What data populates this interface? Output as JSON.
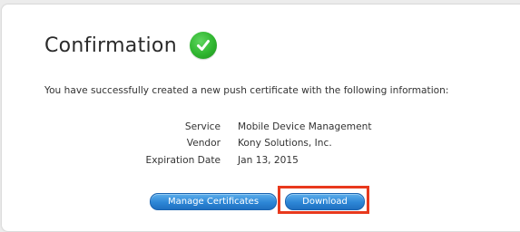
{
  "page": {
    "title": "Confirmation",
    "intro": "You have successfully created a new push certificate with the following information:"
  },
  "details": [
    {
      "label": "Service",
      "value": "Mobile Device Management"
    },
    {
      "label": "Vendor",
      "value": "Kony Solutions, Inc."
    },
    {
      "label": "Expiration Date",
      "value": "Jan 13, 2015"
    }
  ],
  "buttons": {
    "manage_label": "Manage Certificates",
    "download_label": "Download"
  },
  "colors": {
    "success_green": "#2fb52f",
    "button_blue": "#2d86d6",
    "highlight_red": "#e8391d"
  },
  "icons": {
    "confirmation": "checkmark-icon"
  }
}
